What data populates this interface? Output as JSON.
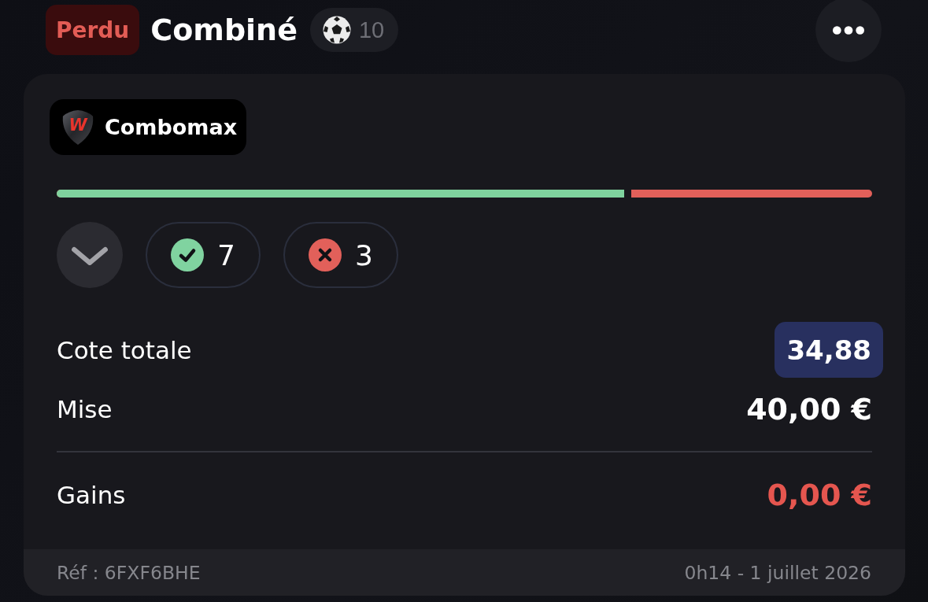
{
  "header": {
    "status": {
      "label": "Perdu",
      "kind": "lost"
    },
    "title": "Combiné",
    "selection_count": "10"
  },
  "card": {
    "promo": {
      "logo_letter": "W",
      "label": "Combomax"
    },
    "progress": {
      "level": 0.7
    },
    "expand_button": {
      "expanded": false
    },
    "tallies": [
      {
        "kind": "won",
        "count": "7"
      },
      {
        "kind": "lost",
        "count": "3"
      }
    ],
    "summary": [
      {
        "kind": "odds",
        "label": "Cote totale",
        "value": "34,88"
      },
      {
        "kind": "stake",
        "label": "Mise",
        "value": "40,00 €"
      },
      {
        "kind": "winnings",
        "label": "Gains",
        "value": "0,00 €"
      }
    ],
    "footer": {
      "reference": "Réf : 6FXF6BHE",
      "date": "0h14 - 1 juillet 2026"
    }
  }
}
